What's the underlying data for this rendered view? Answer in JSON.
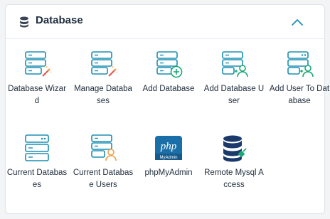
{
  "section": {
    "title": "Database",
    "icon": "database-icon",
    "collapse_icon": "chevron-up-icon"
  },
  "colors": {
    "accent": "#1b8fb3",
    "green": "#19a974",
    "orange": "#f0a04b",
    "text": "#1f2d3d"
  },
  "tiles": [
    {
      "label": "Database Wizard",
      "icon": "database-wizard-icon"
    },
    {
      "label": "Manage Databases",
      "icon": "manage-databases-icon"
    },
    {
      "label": "Add Database",
      "icon": "add-database-icon"
    },
    {
      "label": "Add Database User",
      "icon": "add-database-user-icon"
    },
    {
      "label": "Add User To Database",
      "icon": "add-user-to-database-icon"
    },
    {
      "label": "Current Databases",
      "icon": "current-databases-icon"
    },
    {
      "label": "Current Database Users",
      "icon": "current-database-users-icon"
    },
    {
      "label": "phpMyAdmin",
      "icon": "phpmyadmin-icon"
    },
    {
      "label": "Remote Mysql Access",
      "icon": "remote-mysql-access-icon"
    }
  ],
  "phpmyadmin_logo": {
    "text": "php",
    "subtext": "MyAdmin"
  }
}
